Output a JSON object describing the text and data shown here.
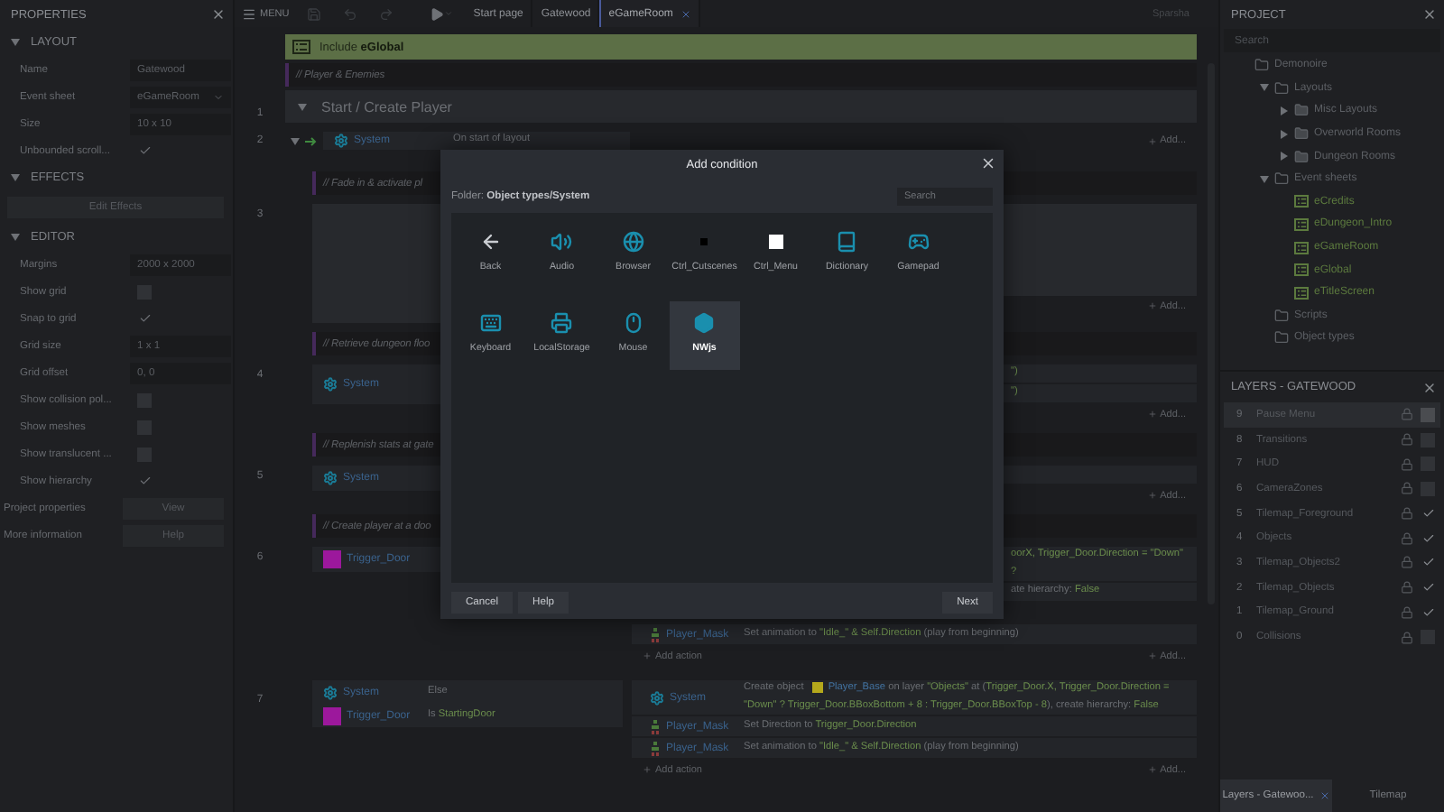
{
  "properties_panel": {
    "title": "PROPERTIES",
    "sections": [
      {
        "title": "LAYOUT",
        "expanded": true,
        "rows": [
          {
            "kind": "text",
            "label": "Name",
            "value": "Gatewood"
          },
          {
            "kind": "dropdown",
            "label": "Event sheet",
            "value": "eGameRoom"
          },
          {
            "kind": "text",
            "label": "Size",
            "value": "10 x 10"
          },
          {
            "kind": "check",
            "label": "Unbounded scroll...",
            "checked": true
          }
        ]
      },
      {
        "title": "EFFECTS",
        "expanded": true,
        "rows": [
          {
            "kind": "button",
            "value": "Edit Effects"
          }
        ]
      },
      {
        "title": "EDITOR",
        "expanded": true,
        "rows": [
          {
            "kind": "text",
            "label": "Margins",
            "value": "2000 x 2000"
          },
          {
            "kind": "check",
            "label": "Show grid",
            "checked": false
          },
          {
            "kind": "check",
            "label": "Snap to grid",
            "checked": true
          },
          {
            "kind": "text",
            "label": "Grid size",
            "value": "1 x 1"
          },
          {
            "kind": "text",
            "label": "Grid offset",
            "value": "0, 0"
          },
          {
            "kind": "check",
            "label": "Show collision pol...",
            "checked": false
          },
          {
            "kind": "check",
            "label": "Show meshes",
            "checked": false
          },
          {
            "kind": "check",
            "label": "Show translucent ...",
            "checked": false
          },
          {
            "kind": "check",
            "label": "Show hierarchy",
            "checked": true
          }
        ]
      }
    ],
    "footer": [
      {
        "label": "Project properties",
        "button": "View"
      },
      {
        "label": "More information",
        "button": "Help"
      }
    ]
  },
  "toolbar": {
    "menu": "MENU",
    "tabs": [
      {
        "label": "Start page",
        "selected": false,
        "closable": false
      },
      {
        "label": "Gatewood",
        "selected": false,
        "closable": false
      },
      {
        "label": "eGameRoom",
        "selected": true,
        "closable": true
      }
    ],
    "user": "Sparsha"
  },
  "event_sheet": {
    "include": "Include **eGlobal**",
    "comment": "// Player & Enemies",
    "group": {
      "line": "1",
      "title": "Start / Create Player",
      "expanded": true
    },
    "event2": {
      "line": "2",
      "expanded": true,
      "object": {
        "kind": "system",
        "name": "System"
      },
      "condition": "On start of layout",
      "add": "Add..."
    },
    "band": [
      {
        "kind": "comment",
        "text": "// Fade in & activate pl"
      },
      {
        "kind": "block",
        "line": "3",
        "add": "Add..."
      },
      {
        "kind": "comment",
        "text": "// Retrieve dungeon floo"
      },
      {
        "kind": "event",
        "line": "4",
        "object": {
          "kind": "system",
          "name": "System"
        },
        "right_lines": [
          [
            {
              "kind": "value",
              "text": "\")"
            }
          ],
          [
            {
              "kind": "value",
              "text": "\")"
            }
          ]
        ],
        "add": "Add..."
      },
      {
        "kind": "comment",
        "text": "// Replenish stats at gate"
      },
      {
        "kind": "event",
        "line": "5",
        "object": {
          "kind": "system",
          "name": "System"
        },
        "add": "Add..."
      },
      {
        "kind": "comment",
        "text": "// Create player at a doo"
      },
      {
        "kind": "event",
        "line": "6",
        "object": {
          "kind": "swatch",
          "name": "Trigger_Door",
          "color": "#9c189c"
        },
        "right_lines": [
          [
            {
              "kind": "value",
              "text": "oorX, Trigger_Door.Direction = \"Down\" ?"
            }
          ],
          [
            {
              "kind": "plain",
              "text": "ate hierarchy: "
            },
            {
              "kind": "value",
              "text": "False"
            }
          ]
        ]
      }
    ],
    "event6_actions": [
      {
        "object": {
          "kind": "sprite",
          "name": "Player_Mask"
        },
        "segments": [
          {
            "kind": "plain",
            "text": "Set animation to "
          },
          {
            "kind": "value",
            "text": "\"Idle_\" & Self.Direction"
          },
          {
            "kind": "plain",
            "text": " (play from beginning)"
          }
        ]
      }
    ],
    "event6_add_action": "Add action",
    "event6_add": "Add...",
    "event7": {
      "line": "7",
      "conditions": [
        {
          "object": {
            "kind": "system",
            "name": "System"
          },
          "segments": [
            {
              "kind": "plain",
              "text": "Else"
            }
          ]
        },
        {
          "object": {
            "kind": "swatch",
            "name": "Trigger_Door",
            "color": "#9c189c"
          },
          "segments": [
            {
              "kind": "plain",
              "text": "Is "
            },
            {
              "kind": "value",
              "text": "StartingDoor"
            }
          ]
        }
      ],
      "actions": [
        {
          "object": {
            "kind": "system",
            "name": "System"
          },
          "segments": [
            {
              "kind": "plain",
              "text": "Create object "
            },
            {
              "kind": "swatch",
              "color": "#b4a81c"
            },
            {
              "kind": "object",
              "text": "Player_Base"
            },
            {
              "kind": "plain",
              "text": " on layer "
            },
            {
              "kind": "value",
              "text": "\"Objects\""
            },
            {
              "kind": "plain",
              "text": " at ("
            },
            {
              "kind": "value",
              "text": "Trigger_Door.X, Trigger_Door.Direction = \"Down\" ? Trigger_Door.BBoxBottom + 8 : Trigger_Door.BBoxTop - 8"
            },
            {
              "kind": "plain",
              "text": "), create hierarchy: "
            },
            {
              "kind": "value",
              "text": "False"
            }
          ]
        },
        {
          "object": {
            "kind": "sprite",
            "name": "Player_Mask"
          },
          "segments": [
            {
              "kind": "plain",
              "text": "Set Direction to "
            },
            {
              "kind": "value",
              "text": "Trigger_Door.Direction"
            }
          ]
        },
        {
          "object": {
            "kind": "sprite",
            "name": "Player_Mask"
          },
          "segments": [
            {
              "kind": "plain",
              "text": "Set animation to "
            },
            {
              "kind": "value",
              "text": "\"Idle_\" & Self.Direction"
            },
            {
              "kind": "plain",
              "text": " (play from beginning)"
            }
          ]
        }
      ],
      "add_action": "Add action",
      "add": "Add..."
    }
  },
  "dialog": {
    "title": "Add condition",
    "folder_label": "Folder: ",
    "folder": "Object types/System",
    "search": {
      "placeholder": "Search"
    },
    "items": [
      {
        "label": "Back",
        "selected": false
      },
      {
        "label": "Audio",
        "selected": false
      },
      {
        "label": "Browser",
        "selected": false
      },
      {
        "label": "Ctrl_Cutscenes",
        "selected": false,
        "color": "#000000"
      },
      {
        "label": "Ctrl_Menu",
        "selected": false,
        "color": "#ffffff"
      },
      {
        "label": "Dictionary",
        "selected": false
      },
      {
        "label": "Gamepad",
        "selected": false
      },
      {
        "label": "Keyboard",
        "selected": false
      },
      {
        "label": "LocalStorage",
        "selected": false
      },
      {
        "label": "Mouse",
        "selected": false
      },
      {
        "label": "NWjs",
        "selected": true
      }
    ],
    "buttons_left": [
      "Cancel",
      "Help"
    ],
    "button_right": "Next"
  },
  "project_panel": {
    "title": "PROJECT",
    "search": {
      "placeholder": "Search"
    },
    "tree": [
      {
        "kind": "folder",
        "label": "Demonoire",
        "children": [
          {
            "kind": "folder",
            "label": "Layouts",
            "expanded": true,
            "children": [
              {
                "kind": "folder",
                "label": "Misc Layouts",
                "expanded": false
              },
              {
                "kind": "folder",
                "label": "Overworld Rooms",
                "expanded": false
              },
              {
                "kind": "folder",
                "label": "Dungeon Rooms",
                "expanded": false
              }
            ]
          },
          {
            "kind": "folder",
            "label": "Event sheets",
            "expanded": true,
            "children": [
              {
                "kind": "sheet",
                "label": "eCredits"
              },
              {
                "kind": "sheet",
                "label": "eDungeon_Intro"
              },
              {
                "kind": "sheet",
                "label": "eGameRoom"
              },
              {
                "kind": "sheet",
                "label": "eGlobal"
              },
              {
                "kind": "sheet",
                "label": "eTitleScreen"
              }
            ]
          },
          {
            "kind": "folder",
            "label": "Scripts"
          },
          {
            "kind": "folder",
            "label": "Object types"
          }
        ]
      }
    ]
  },
  "layers_panel": {
    "title": "LAYERS - GATEWOOD",
    "layers": [
      {
        "index": "9",
        "name": "Pause Menu",
        "selected": true,
        "visible": false
      },
      {
        "index": "8",
        "name": "Transitions",
        "selected": false,
        "visible": false
      },
      {
        "index": "7",
        "name": "HUD",
        "selected": false,
        "visible": false
      },
      {
        "index": "6",
        "name": "CameraZones",
        "selected": false,
        "visible": false
      },
      {
        "index": "5",
        "name": "Tilemap_Foreground",
        "selected": false,
        "visible": true
      },
      {
        "index": "4",
        "name": "Objects",
        "selected": false,
        "visible": true
      },
      {
        "index": "3",
        "name": "Tilemap_Objects2",
        "selected": false,
        "visible": true
      },
      {
        "index": "2",
        "name": "Tilemap_Objects",
        "selected": false,
        "visible": true
      },
      {
        "index": "1",
        "name": "Tilemap_Ground",
        "selected": false,
        "visible": true
      },
      {
        "index": "0",
        "name": "Collisions",
        "selected": false,
        "visible": false
      }
    ],
    "tabs": [
      {
        "label": "Layers - Gatewoo...",
        "selected": true,
        "closable": true
      },
      {
        "label": "Tilemap",
        "selected": false,
        "closable": false
      }
    ]
  }
}
